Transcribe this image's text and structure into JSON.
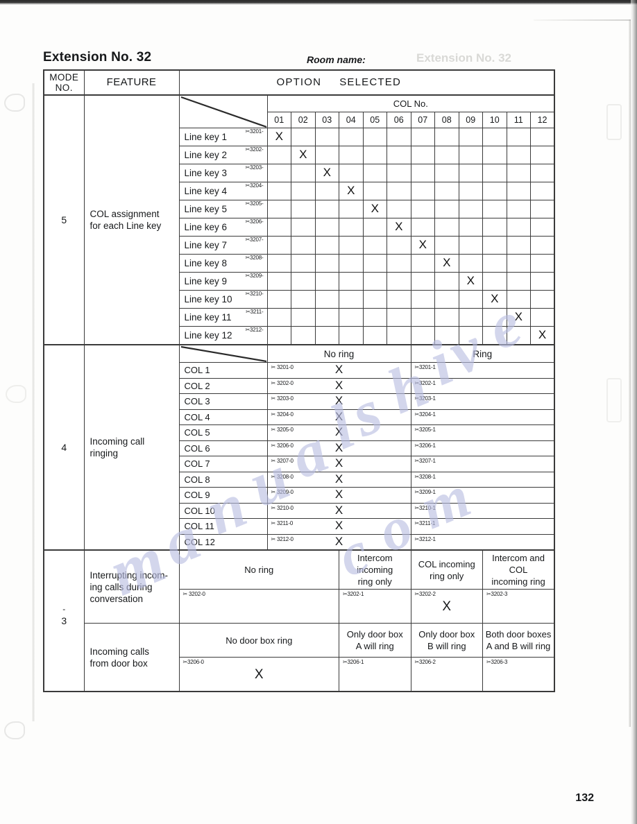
{
  "document": {
    "extension_title": "Extension No. 32",
    "room_name_label": "Room name:",
    "page_number": "132"
  },
  "table_header": {
    "mode_no_line1": "MODE",
    "mode_no_line2": "NO.",
    "feature": "FEATURE",
    "option": "OPTION",
    "selected": "SELECTED"
  },
  "sections": {
    "mode5": {
      "mode_no": "5",
      "feature_line1": "COL assignment",
      "feature_line2": "for each Line key",
      "col_no_header": "COL No.",
      "col_numbers": [
        "01",
        "02",
        "03",
        "04",
        "05",
        "06",
        "07",
        "08",
        "09",
        "10",
        "11",
        "12"
      ],
      "rows": [
        {
          "label": "Line key 1",
          "code": "✂3201-",
          "selected_col": 1
        },
        {
          "label": "Line key 2",
          "code": "✂3202-",
          "selected_col": 2
        },
        {
          "label": "Line key 3",
          "code": "✂3203-",
          "selected_col": 3
        },
        {
          "label": "Line key 4",
          "code": "✂3204-",
          "selected_col": 4
        },
        {
          "label": "Line key 5",
          "code": "✂3205-",
          "selected_col": 5
        },
        {
          "label": "Line key 6",
          "code": "✂3206-",
          "selected_col": 6
        },
        {
          "label": "Line key 7",
          "code": "✂3207-",
          "selected_col": 7
        },
        {
          "label": "Line key 8",
          "code": "✂3208-",
          "selected_col": 8
        },
        {
          "label": "Line key 9",
          "code": "✂3209-",
          "selected_col": 9
        },
        {
          "label": "Line key 10",
          "code": "✂3210-",
          "selected_col": 10
        },
        {
          "label": "Line key 11",
          "code": "✂3211-",
          "selected_col": 11
        },
        {
          "label": "Line key 12",
          "code": "✂3212-",
          "selected_col": 12
        }
      ]
    },
    "mode4": {
      "mode_no": "4",
      "feature_line1": "Incoming call",
      "feature_line2": "ringing",
      "option_headers": [
        "No ring",
        "Ring"
      ],
      "rows": [
        {
          "label": "COL 1",
          "no_ring_code": "✂ 3201-0",
          "ring_code": "✂3201-1",
          "selected": "no_ring"
        },
        {
          "label": "COL 2",
          "no_ring_code": "✂ 3202-0",
          "ring_code": "✂3202-1",
          "selected": "no_ring"
        },
        {
          "label": "COL 3",
          "no_ring_code": "✂ 3203-0",
          "ring_code": "✂3203-1",
          "selected": "no_ring"
        },
        {
          "label": "COL 4",
          "no_ring_code": "✂ 3204-0",
          "ring_code": "✂3204-1",
          "selected": "no_ring"
        },
        {
          "label": "COL 5",
          "no_ring_code": "✂ 3205-0",
          "ring_code": "✂3205-1",
          "selected": "no_ring"
        },
        {
          "label": "COL 6",
          "no_ring_code": "✂ 3206-0",
          "ring_code": "✂3206-1",
          "selected": "no_ring"
        },
        {
          "label": "COL 7",
          "no_ring_code": "✂ 3207-0",
          "ring_code": "✂3207-1",
          "selected": "no_ring"
        },
        {
          "label": "COL 8",
          "no_ring_code": "✂ 3208-0",
          "ring_code": "✂3208-1",
          "selected": "no_ring"
        },
        {
          "label": "COL 9",
          "no_ring_code": "✂ 3209-0",
          "ring_code": "✂3209-1",
          "selected": "no_ring"
        },
        {
          "label": "COL 10",
          "no_ring_code": "✂ 3210-0",
          "ring_code": "✂3210-1",
          "selected": "no_ring"
        },
        {
          "label": "COL 11",
          "no_ring_code": "✂ 3211-0",
          "ring_code": "✂3211-1",
          "selected": "no_ring"
        },
        {
          "label": "COL 12",
          "no_ring_code": "✂ 3212-0",
          "ring_code": "✂3212-1",
          "selected": "no_ring"
        }
      ]
    },
    "mode3": {
      "mode_no": "3",
      "blocks": [
        {
          "feature_line1": "Interrupting incom-",
          "feature_line2": "ing calls during",
          "feature_line3": "conversation",
          "options": [
            {
              "label_line1": "No ring",
              "label_line2": "",
              "code": "✂ 3202-0",
              "selected": false
            },
            {
              "label_line1": "Intercom incoming",
              "label_line2": "ring only",
              "code": "✂3202-1",
              "selected": false
            },
            {
              "label_line1": "COL incoming",
              "label_line2": "ring only",
              "code": "✂3202-2",
              "selected": true
            },
            {
              "label_line1": "Intercom and COL",
              "label_line2": "incoming ring",
              "code": "✂3202-3",
              "selected": false
            }
          ]
        },
        {
          "feature_line1": "Incoming calls",
          "feature_line2": "from door box",
          "feature_line3": "",
          "options": [
            {
              "label_line1": "No door box ring",
              "label_line2": "",
              "code": "✂3206-0",
              "selected": true
            },
            {
              "label_line1": "Only door box",
              "label_line2": "A will ring",
              "code": "✂3206-1",
              "selected": false
            },
            {
              "label_line1": "Only door box",
              "label_line2": "B will ring",
              "code": "✂3206-2",
              "selected": false
            },
            {
              "label_line1": "Both door boxes",
              "label_line2": "A and B will ring",
              "code": "✂3206-3",
              "selected": false
            }
          ]
        }
      ]
    }
  },
  "marks": {
    "x_symbol": "X"
  },
  "watermark": {
    "text": "manualshive.com"
  },
  "colors": {
    "ink": "#16181a",
    "rule": "#3a3a3a",
    "watermark": "#b9bde2",
    "paper": "#fdfdfc"
  }
}
